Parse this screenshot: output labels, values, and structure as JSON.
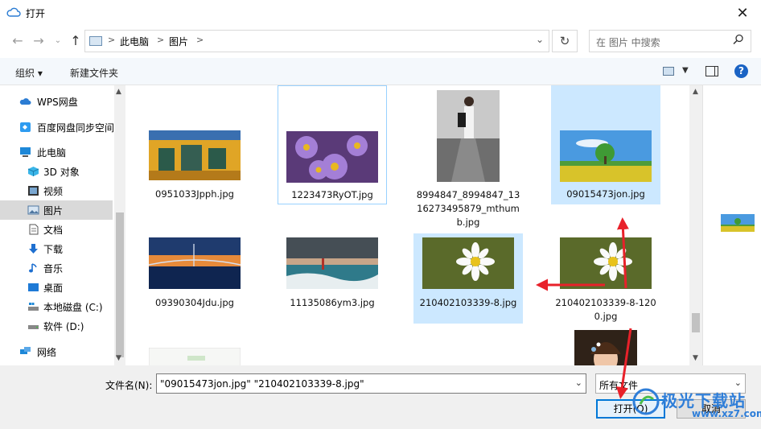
{
  "window": {
    "title": "打开"
  },
  "nav": {
    "back_icon": "back-arrow-icon",
    "forward_icon": "forward-arrow-icon",
    "recent_icon": "chevron-down-icon",
    "up_icon": "up-arrow-icon"
  },
  "address": {
    "crumbs": [
      "此电脑",
      "图片"
    ],
    "separator": ">"
  },
  "search": {
    "placeholder": "在 图片 中搜索"
  },
  "toolbar": {
    "organize": "组织 ▾",
    "new_folder": "新建文件夹"
  },
  "sidebar": {
    "items": [
      {
        "label": "WPS网盘",
        "icon": "cloud-icon"
      },
      {
        "label": "百度网盘同步空间",
        "icon": "baidu-sync-icon"
      },
      {
        "label": "此电脑",
        "icon": "computer-icon"
      },
      {
        "label": "3D 对象",
        "icon": "3d-objects-icon"
      },
      {
        "label": "视频",
        "icon": "video-icon"
      },
      {
        "label": "图片",
        "icon": "pictures-icon",
        "selected": true
      },
      {
        "label": "文档",
        "icon": "documents-icon"
      },
      {
        "label": "下载",
        "icon": "downloads-icon"
      },
      {
        "label": "音乐",
        "icon": "music-icon"
      },
      {
        "label": "桌面",
        "icon": "desktop-icon"
      },
      {
        "label": "本地磁盘 (C:)",
        "icon": "drive-c-icon"
      },
      {
        "label": "软件 (D:)",
        "icon": "drive-d-icon"
      },
      {
        "label": "网络",
        "icon": "network-icon"
      }
    ]
  },
  "files": [
    {
      "name": "0951033Jpph.jpg",
      "state": "normal"
    },
    {
      "name": "1223473RyOT.jpg",
      "state": "focused"
    },
    {
      "name": "8994847_8994847_1316273495879_mthumb.jpg",
      "lines": [
        "8994847_8994847_13",
        "16273495879_mthum",
        "b.jpg"
      ],
      "state": "normal"
    },
    {
      "name": "09015473jon.jpg",
      "state": "selected"
    },
    {
      "name": "09390304Jdu.jpg",
      "state": "normal"
    },
    {
      "name": "11135086ym3.jpg",
      "state": "normal"
    },
    {
      "name": "210402103339-8.jpg",
      "state": "selected"
    },
    {
      "name": "210402103339-8-1200.jpg",
      "lines": [
        "210402103339-8-120",
        "0.jpg"
      ],
      "state": "normal"
    }
  ],
  "footer": {
    "filename_label": "文件名(N):",
    "filename_value": "\"09015473jon.jpg\" \"210402103339-8.jpg\"",
    "filetype_value": "所有文件",
    "open_label": "打开(O)",
    "cancel_label": "取消"
  },
  "watermark": {
    "brand": "极光下载站",
    "url": "www.xz7.com"
  },
  "colors": {
    "accent": "#0078d7",
    "selection": "#cce8ff",
    "annotation_arrow": "#e8212a"
  }
}
